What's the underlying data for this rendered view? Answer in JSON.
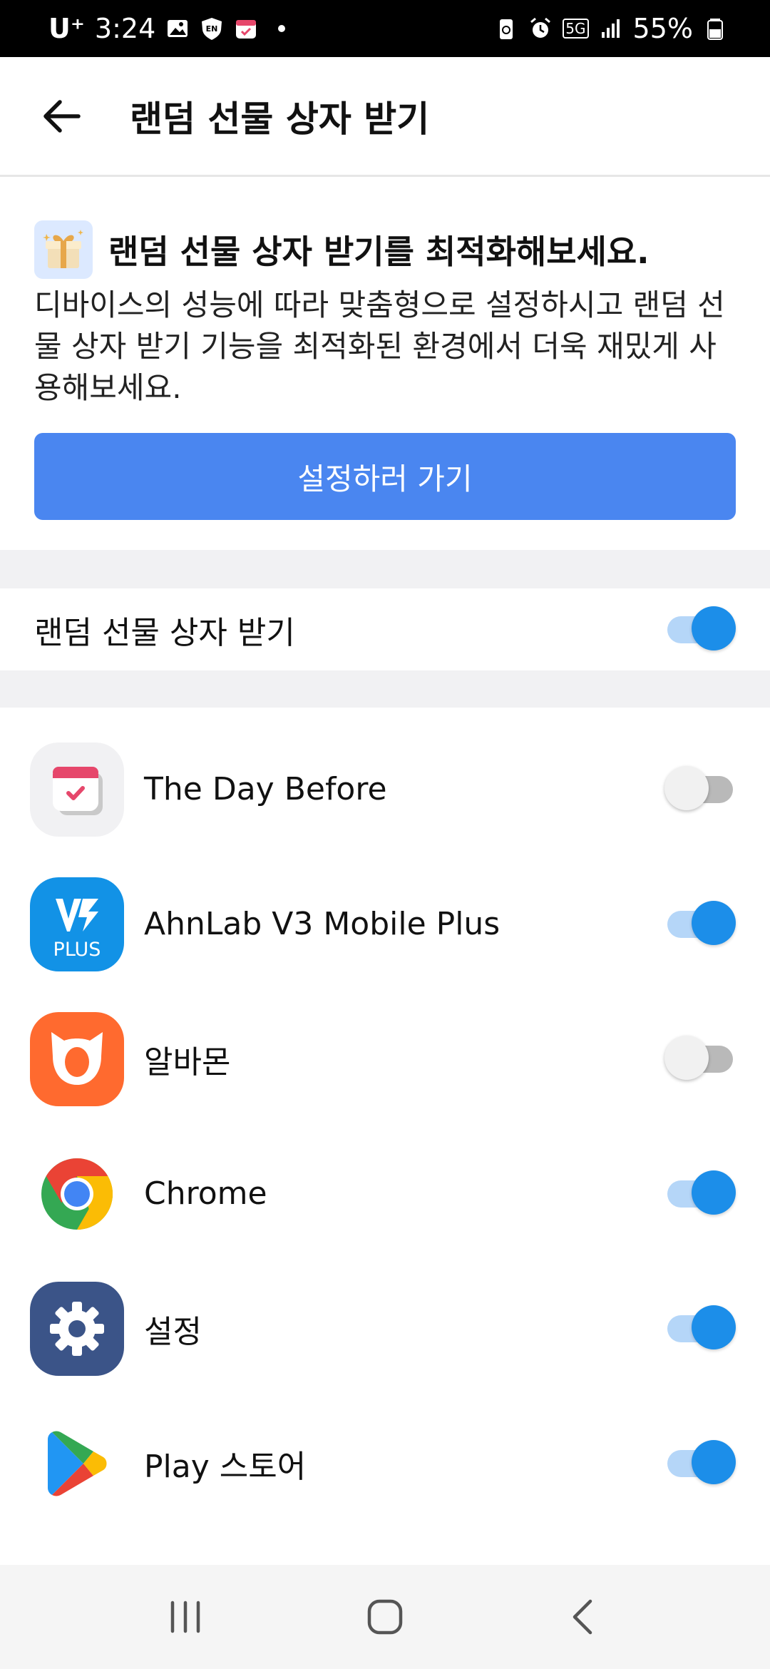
{
  "status_bar": {
    "carrier": "U⁺",
    "time": "3:24",
    "battery": "55%",
    "network": "5G"
  },
  "app_bar": {
    "title": "랜덤 선물 상자 받기"
  },
  "promo": {
    "title": "랜덤 선물 상자 받기를 최적화해보세요.",
    "description": "디바이스의 성능에 따라 맞춤형으로 설정하시고 랜덤 선물 상자 받기 기능을 최적화된 환경에서 더욱 재밌게 사용해보세요.",
    "button_label": "설정하러 가기",
    "accent_color": "#4a86f0"
  },
  "master_toggle": {
    "label": "랜덤 선물 상자 받기",
    "enabled": true
  },
  "apps": [
    {
      "name": "The Day Before",
      "icon": "calendar-check-icon",
      "enabled": false
    },
    {
      "name": "AhnLab V3 Mobile Plus",
      "icon": "v3-plus-icon",
      "enabled": true
    },
    {
      "name": "알바몬",
      "icon": "albamon-icon",
      "enabled": false
    },
    {
      "name": "Chrome",
      "icon": "chrome-icon",
      "enabled": true
    },
    {
      "name": "설정",
      "icon": "settings-gear-icon",
      "enabled": true
    },
    {
      "name": "Play 스토어",
      "icon": "play-store-icon",
      "enabled": true
    }
  ],
  "colors": {
    "toggle_on": "#1c8ee9",
    "toggle_on_track": "#b5d6f8",
    "toggle_off_track": "#b9b9b9"
  }
}
